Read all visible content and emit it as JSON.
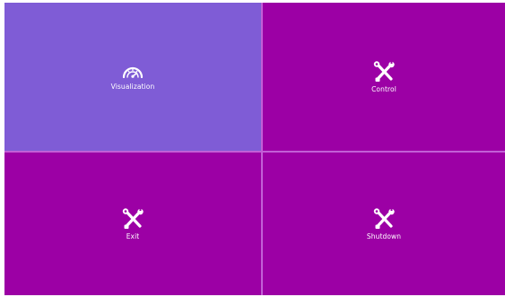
{
  "tiles": [
    {
      "label": "Visualization",
      "icon": "gauge-icon",
      "color": "#7f5cd6",
      "selected": true
    },
    {
      "label": "Control",
      "icon": "tools-icon",
      "color": "#9c00a5",
      "selected": false
    },
    {
      "label": "Exit",
      "icon": "tools-icon",
      "color": "#9c00a5",
      "selected": false
    },
    {
      "label": "Shutdown",
      "icon": "tools-icon",
      "color": "#9c00a5",
      "selected": false
    }
  ],
  "colors": {
    "selected_tile": "#7f5cd6",
    "tile": "#9c00a5",
    "divider": "#c25fd6",
    "text": "#ffffff"
  }
}
